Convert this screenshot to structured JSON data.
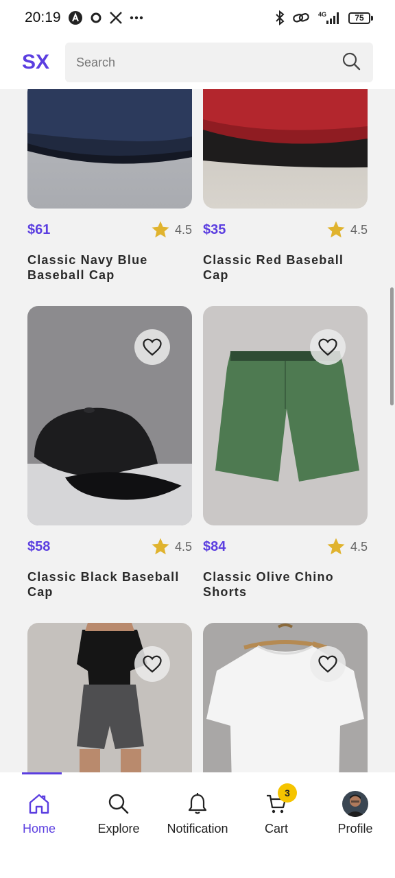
{
  "status_bar": {
    "time": "20:19",
    "battery": "75",
    "network": "4G"
  },
  "header": {
    "logo": "SX",
    "search_placeholder": "Search"
  },
  "products": [
    {
      "price": "$61",
      "rating": "4.5",
      "title": "Classic Navy Blue Baseball Cap",
      "image": "navy-cap"
    },
    {
      "price": "$35",
      "rating": "4.5",
      "title": "Classic Red Baseball Cap",
      "image": "red-cap"
    },
    {
      "price": "$58",
      "rating": "4.5",
      "title": "Classic Black Baseball Cap",
      "image": "black-cap"
    },
    {
      "price": "$84",
      "rating": "4.5",
      "title": "Classic Olive Chino Shorts",
      "image": "olive-shorts"
    },
    {
      "image": "black-top-shorts-outfit"
    },
    {
      "image": "white-tshirt"
    }
  ],
  "bottom_nav": {
    "items": [
      {
        "label": "Home",
        "icon": "home-icon",
        "active": true
      },
      {
        "label": "Explore",
        "icon": "search-icon"
      },
      {
        "label": "Notification",
        "icon": "bell-icon"
      },
      {
        "label": "Cart",
        "icon": "cart-icon",
        "badge": "3"
      },
      {
        "label": "Profile",
        "icon": "avatar"
      }
    ]
  },
  "colors": {
    "accent": "#5b3ee0",
    "star": "#e0b32e",
    "badge": "#f5c400",
    "background": "#f2f2f2"
  }
}
